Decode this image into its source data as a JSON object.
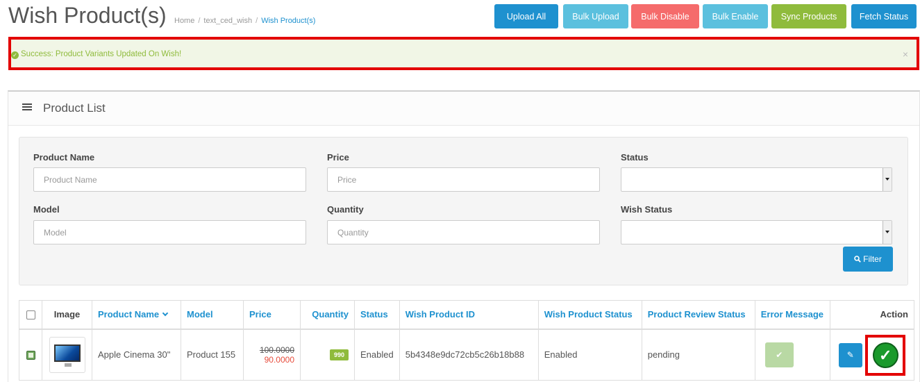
{
  "header": {
    "title": "Wish Product(s)",
    "breadcrumb": [
      "Home",
      "text_ced_wish",
      "Wish Product(s)"
    ]
  },
  "toolbar": {
    "upload_all": "Upload All",
    "bulk_upload": "Bulk Upload",
    "bulk_disable": "Bulk Disable",
    "bulk_enable": "Bulk Enable",
    "sync_products": "Sync Products",
    "fetch_status": "Fetch Status"
  },
  "colors": {
    "primary": "#1e91cf",
    "info": "#5bc0de",
    "danger": "#f56b6b",
    "success": "#8fbb3c",
    "highlight": "#e30000"
  },
  "alert": {
    "icon": "check-circle-icon",
    "message": "Success: Product Variants Updated On Wish!",
    "close": "×"
  },
  "panel": {
    "icon": "list-icon",
    "title": "Product List"
  },
  "filters": {
    "product_name": {
      "label": "Product Name",
      "placeholder": "Product Name"
    },
    "price": {
      "label": "Price",
      "placeholder": "Price"
    },
    "status": {
      "label": "Status",
      "value": ""
    },
    "model": {
      "label": "Model",
      "placeholder": "Model"
    },
    "quantity": {
      "label": "Quantity",
      "placeholder": "Quantity"
    },
    "wish_status": {
      "label": "Wish Status",
      "value": ""
    },
    "filter_button": "Filter",
    "filter_icon": "search-icon"
  },
  "table": {
    "columns": {
      "image": "Image",
      "product_name": "Product Name",
      "model": "Model",
      "price": "Price",
      "quantity": "Quantity",
      "status": "Status",
      "wish_product_id": "Wish Product ID",
      "wish_product_status": "Wish Product Status",
      "product_review_status": "Product Review Status",
      "error_message": "Error Message",
      "action": "Action"
    },
    "rows": [
      {
        "selected": true,
        "image_icon": "monitor-thumbnail",
        "product_name": "Apple Cinema 30\"",
        "model": "Product 155",
        "price_old": "100.0000",
        "price_new": "90.0000",
        "quantity": "990",
        "status": "Enabled",
        "wish_product_id": "5b4348e9dc72cb5c26b18b88",
        "wish_product_status": "Enabled",
        "product_review_status": "pending",
        "error_icon": "check-icon",
        "edit_icon": "pencil-icon",
        "sync_icon": "check-circle-icon"
      }
    ]
  }
}
